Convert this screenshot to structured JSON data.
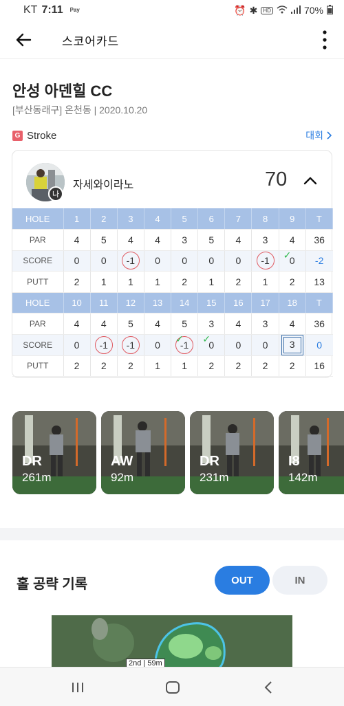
{
  "status": {
    "carrier": "KT",
    "time": "7:11",
    "pay": "Pay",
    "battery": "70%"
  },
  "appbar": {
    "title": "스코어카드"
  },
  "course": {
    "name": "안성 아덴힐 CC",
    "subtitle": "[부산동래구] 온천동 | 2020.10.20",
    "mode_badge": "G",
    "mode": "Stroke",
    "tour_link": "대회"
  },
  "player": {
    "name": "자세와이라노",
    "total": "70",
    "badge": "나"
  },
  "scorecard": {
    "row_labels": {
      "hole": "HOLE",
      "par": "PAR",
      "score": "SCORE",
      "putt": "PUTT"
    },
    "front": {
      "holes": [
        "1",
        "2",
        "3",
        "4",
        "5",
        "6",
        "7",
        "8",
        "9",
        "T"
      ],
      "par": [
        "4",
        "5",
        "4",
        "4",
        "3",
        "5",
        "4",
        "3",
        "4",
        "36"
      ],
      "score": [
        "0",
        "0",
        "-1",
        "0",
        "0",
        "0",
        "0",
        "-1",
        "0",
        "-2"
      ],
      "putt": [
        "2",
        "1",
        "1",
        "1",
        "2",
        "1",
        "2",
        "1",
        "2",
        "13"
      ]
    },
    "back": {
      "holes": [
        "10",
        "11",
        "12",
        "13",
        "14",
        "15",
        "16",
        "17",
        "18",
        "T"
      ],
      "par": [
        "4",
        "4",
        "5",
        "4",
        "5",
        "3",
        "4",
        "3",
        "4",
        "36"
      ],
      "score": [
        "0",
        "-1",
        "-1",
        "0",
        "-1",
        "0",
        "0",
        "0",
        "3",
        "0"
      ],
      "putt": [
        "2",
        "2",
        "2",
        "1",
        "1",
        "2",
        "2",
        "2",
        "2",
        "16"
      ]
    },
    "colors": {
      "header": "#a7c1e6",
      "birdie_circle": "#e05a60",
      "check": "#2db84a",
      "total_blue": "#2a7de1"
    }
  },
  "shots": [
    {
      "club": "DR",
      "distance": "261m"
    },
    {
      "club": "AW",
      "distance": "92m"
    },
    {
      "club": "DR",
      "distance": "231m"
    },
    {
      "club": "I8",
      "distance": "142m"
    }
  ],
  "hole_record": {
    "title": "홀 공략 기록",
    "tab_out": "OUT",
    "tab_in": "IN",
    "map_label": "2nd | 59m"
  }
}
